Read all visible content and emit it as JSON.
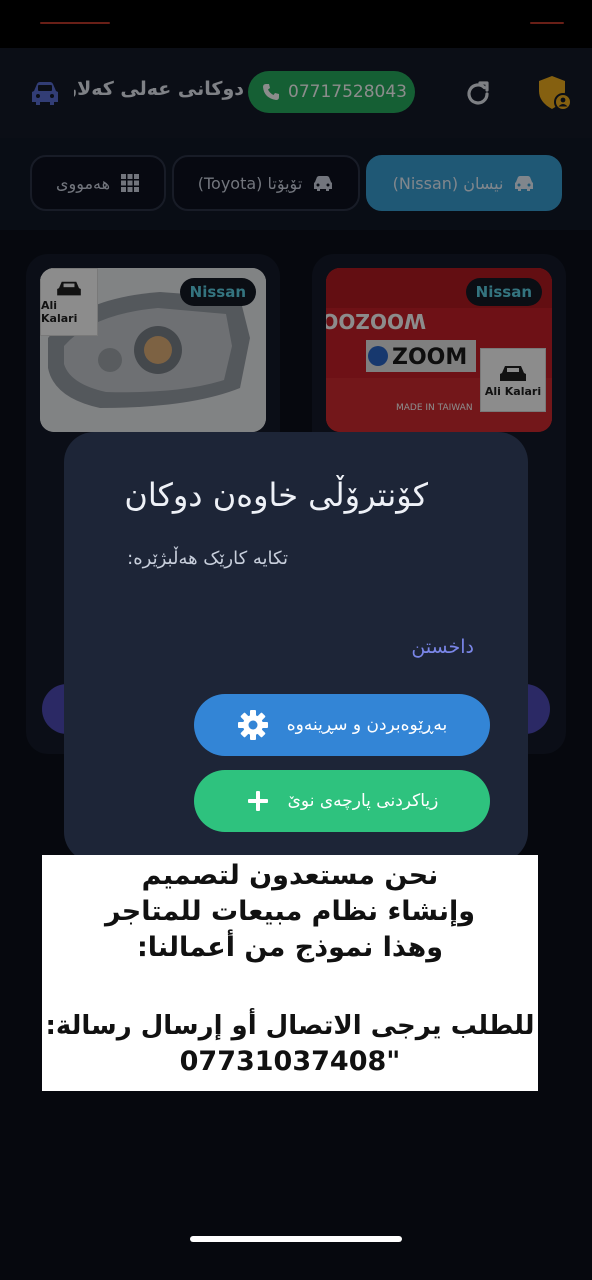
{
  "app_bar": {
    "shop_name": "دوکانی عەلی کەلار...",
    "phone": "07717528043"
  },
  "tabs": [
    {
      "label": "نیسان (Nissan)",
      "active": true
    },
    {
      "label": "تۆیۆتا (Toyota)",
      "active": false
    },
    {
      "label": "هەمووی",
      "active": false
    }
  ],
  "products": [
    {
      "brand": "Nissan",
      "image_text": "ZOOM",
      "logo_text": "Ali Kalari"
    },
    {
      "brand": "Nissan",
      "logo_text": "Ali Kalari"
    }
  ],
  "dialog": {
    "title": "کۆنترۆڵی خاوەن دوکان",
    "subtitle": "تکایە کارێک هەڵبژێرە:",
    "link": "داخستن",
    "manage_button": "بەڕێوەبردن و سڕینەوە",
    "add_button": "زیاکردنی پارچەی نوێ"
  },
  "promo": {
    "line1": "نحن مستعدون لتصميم",
    "line2": "وإنشاء نظام مبيعات للمتاجر",
    "line3": "وهذا نموذج من أعمالنا:",
    "line4": "للطلب يرجى الاتصال أو إرسال رسالة:",
    "line5": "07731037408\""
  },
  "colors": {
    "phone_button": "#27ae60",
    "active_tab": "#3aa0d6",
    "manage_button": "#3385d6",
    "add_button": "#2ec27e",
    "brand_chip_text": "#5fd3e8"
  }
}
